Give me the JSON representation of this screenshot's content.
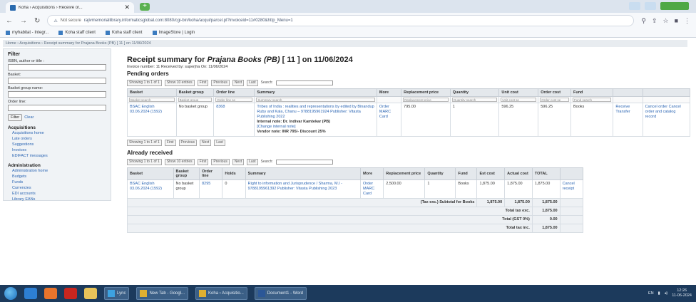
{
  "browser": {
    "tab_title": "Koha › Acquisitions › Receive or...",
    "tab_close": "✕",
    "new_tab": "+",
    "url_security": "Not secure",
    "url": "rajivmemoriallibrary.informaticsglobal.com:8080/cgi-bin/koha/acqui/parcel.pl?invoiceid=11#0280&http_Menu=1",
    "bookmarks": [
      "myhabitat - Integr...",
      "Koha staff client",
      "Koha staff client",
      "ImageStore | Login"
    ]
  },
  "breadcrumb": "Home › Acquisitions › Receipt summary for Prajana Books (PB) [ 11 ] on 11/06/2024",
  "sidebar": {
    "filter_title": "Filter",
    "fields": [
      {
        "label": "ISBN, author or title :"
      },
      {
        "label": "Basket:"
      },
      {
        "label": "Basket group name:"
      },
      {
        "label": "Order line:"
      }
    ],
    "filter_button": "Filter",
    "clear_link": "Clear",
    "sections": [
      {
        "title": "Acquisitions",
        "items": [
          "Acquisitions home",
          "Late orders",
          "Suggestions",
          "Invoices",
          "EDIFACT messages"
        ]
      },
      {
        "title": "Administration",
        "items": [
          "Administration home",
          "Budgets",
          "Funds",
          "Currencies",
          "EDI accounts",
          "Library EANs"
        ]
      }
    ]
  },
  "main": {
    "title_prefix": "Receipt summary for",
    "title_vendor": "Prajana Books (PB)",
    "title_suffix": "[ 11 ] on 11/06/2024",
    "invoice_line": "Invoice number: 11 Received by: superjha On: 11/06/2024",
    "pending_heading": "Pending orders",
    "received_heading": "Already received",
    "pager": {
      "info": "Showing 1 to 1 of 1",
      "show": "Show 10 entries",
      "first": "First",
      "previous": "Previous",
      "next": "Next",
      "last": "Last",
      "search": "Search:"
    },
    "pending": {
      "headers": [
        "Basket",
        "Basket group",
        "Order line",
        "Summary",
        "More",
        "Replacement price",
        "Quantity",
        "Unit cost",
        "Order cost",
        "Fund",
        "",
        ""
      ],
      "filters": [
        "Basket search",
        "Basket group",
        "Order line se",
        "Summary search",
        "",
        "Replacement price",
        "Quantity search",
        "Unit cost se",
        "Order cost se",
        "Fund search",
        "",
        ""
      ],
      "row": {
        "basket": "BSAC English 03.06.2024 (1592)",
        "basket_group": "No basket group",
        "order_line": "8368",
        "summary": "Tribes of India : realities and representations by edited by Binandup Ruby and Kala, Chanu – 9788195961924 Publisher: Vitasta Publishing 2022",
        "internal_note": "Internal note: Dr. Indivar Kamtekar (PB)",
        "internal_note_link": "[Change internal note]",
        "vendor_note": "Vendor note: INR 795/- Discount 25%",
        "more": "Order MARC Card",
        "replacement_price": "795.00",
        "quantity": "1",
        "unit_cost": "596.25",
        "order_cost": "596.25",
        "fund": "Books",
        "action1": "Receive Transfer",
        "action2": "Cancel order Cancel order and catalog record"
      }
    },
    "received": {
      "headers": [
        "Basket",
        "Basket group",
        "Order line",
        "Holds",
        "Summary",
        "More",
        "Replacement price",
        "Quantity",
        "Fund",
        "Est cost",
        "Actual cost",
        "TOTAL",
        ""
      ],
      "row": {
        "basket": "BSAC English 03.06.2024 (1592)",
        "basket_group": "No basket group",
        "order_line": "8295",
        "holds": "0",
        "summary": "Right to information and Jurisprudence / Sharma, M.I - 9788195961392 Publisher: Vitasta Publishing 2023",
        "more": "Order MARC Card",
        "replacement_price": "2,500.00",
        "quantity": "1",
        "fund": "Books",
        "est_cost": "1,875.00",
        "actual_cost": "1,875.00",
        "total": "1,875.00",
        "action": "Cancel receipt"
      },
      "subtotal_label": "(Tax exc.) Subtotal for Books",
      "subtotal_est": "1,875.00",
      "subtotal_actual": "1,875.00",
      "subtotal_total": "1,875.00",
      "totals": [
        {
          "label": "Total tax exc.",
          "value": "1,875.00"
        },
        {
          "label": "Total (GST 0%)",
          "value": "0.00"
        },
        {
          "label": "Total tax inc.",
          "value": "1,875.00"
        }
      ]
    }
  },
  "taskbar": {
    "apps": [
      "Lync",
      "New Tab - Googl...",
      "Koha › Acquisitio...",
      "Document1 - Word"
    ],
    "time": "12:26",
    "date": "11-06-2024",
    "lang": "EN"
  }
}
